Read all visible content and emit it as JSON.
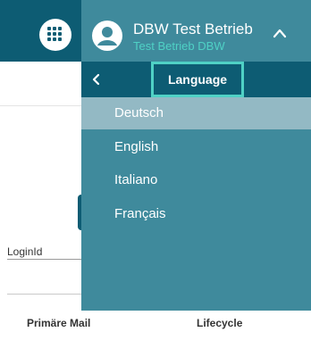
{
  "header": {
    "user_name": "DBW Test Betrieb",
    "tenant": "Test Betrieb DBW"
  },
  "background": {
    "login_label": "LoginId",
    "columns": [
      "Primäre Mail",
      "Lifecycle"
    ]
  },
  "language_menu": {
    "title": "Language",
    "items": [
      {
        "label": "Deutsch",
        "selected": true
      },
      {
        "label": "English",
        "selected": false
      },
      {
        "label": "Italiano",
        "selected": false
      },
      {
        "label": "Français",
        "selected": false
      }
    ]
  },
  "colors": {
    "header_bg": "#0d5c73",
    "panel_bg": "#3f8a9c",
    "accent": "#4fd1c5",
    "selected_bg": "#93b9c4"
  }
}
